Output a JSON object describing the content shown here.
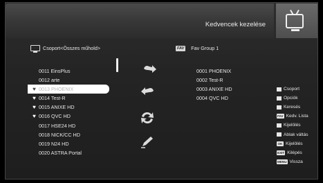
{
  "header": {
    "title": "Kedvencek kezelése"
  },
  "left_panel": {
    "heading": "Csoport<Összes műhold>",
    "channels": [
      {
        "label": "0011 EinsPlus",
        "fav": false,
        "selected": false
      },
      {
        "label": "0012 arte",
        "fav": false,
        "selected": false
      },
      {
        "label": "0013 PHOENIX",
        "fav": true,
        "selected": true
      },
      {
        "label": "0014 Test-R",
        "fav": true,
        "selected": false
      },
      {
        "label": "0015 ANIXE HD",
        "fav": true,
        "selected": false
      },
      {
        "label": "0016 QVC HD",
        "fav": true,
        "selected": false
      },
      {
        "label": "0017 HSE24 HD",
        "fav": false,
        "selected": false
      },
      {
        "label": "0018 NICK/CC HD",
        "fav": false,
        "selected": false
      },
      {
        "label": "0019 N24 HD",
        "fav": false,
        "selected": false
      },
      {
        "label": "0020 ASTRA Portal",
        "fav": false,
        "selected": false
      }
    ]
  },
  "right_panel": {
    "tag": "FAV",
    "heading": "Fav Group 1",
    "channels": [
      "0001 PHOENIX",
      "0002 Test-R",
      "0003 ANIXE HD",
      "0004 QVC HD"
    ]
  },
  "actions": [
    {
      "icon": "add-arrow-icon"
    },
    {
      "icon": "remove-arrow-icon"
    },
    {
      "icon": "move-icon"
    },
    {
      "icon": "rename-icon"
    }
  ],
  "legend": [
    {
      "key": "",
      "label": "Csoport",
      "icon": "green-key-icon"
    },
    {
      "key": "",
      "label": "Opciók",
      "icon": "yellow-key-icon"
    },
    {
      "key": "",
      "label": "Keresés",
      "icon": "search-key-icon"
    },
    {
      "key": "FAV",
      "label": "Kedv. Lista",
      "icon": "fav-key-icon"
    },
    {
      "key": "",
      "label": "Kijelölés",
      "icon": "page-key-icon"
    },
    {
      "key": "",
      "label": "Ablak váltás",
      "icon": "swap-key-icon"
    },
    {
      "key": "OK",
      "label": "Kijelölés",
      "icon": "ok-key-icon"
    },
    {
      "key": "EXIT",
      "label": "Kilépés",
      "icon": "exit-key-icon"
    },
    {
      "key": "MENU",
      "label": "Vissza",
      "icon": "menu-key-icon"
    }
  ],
  "colors": {
    "background": "#000000",
    "panel": "#262626",
    "selection": "#ffffff",
    "text": "#e6e6e6"
  }
}
